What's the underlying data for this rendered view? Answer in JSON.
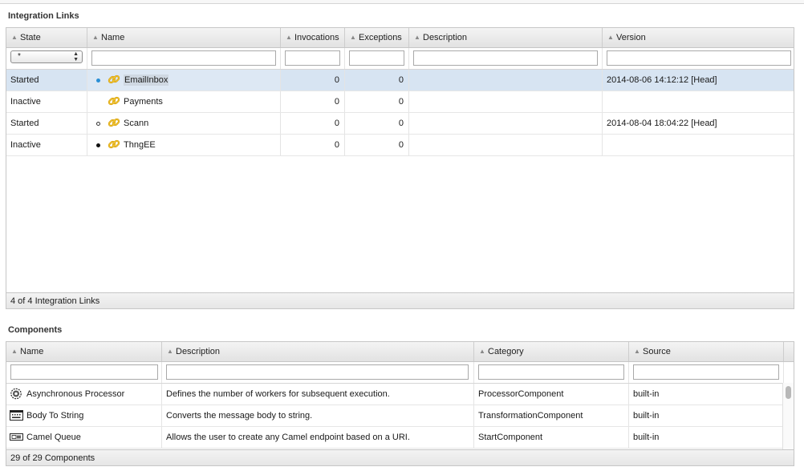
{
  "integration_links": {
    "title": "Integration Links",
    "columns": {
      "state": "State",
      "name": "Name",
      "invocations": "Invocations",
      "exceptions": "Exceptions",
      "description": "Description",
      "version": "Version"
    },
    "state_filter_value": "*",
    "rows": [
      {
        "state": "Started",
        "status_dot": "blue",
        "name": "EmailInbox",
        "invocations": "0",
        "exceptions": "0",
        "description": "",
        "version": "2014-08-06 14:12:12 [Head]"
      },
      {
        "state": "Inactive",
        "status_dot": "none",
        "name": "Payments",
        "invocations": "0",
        "exceptions": "0",
        "description": "",
        "version": ""
      },
      {
        "state": "Started",
        "status_dot": "open",
        "name": "Scann",
        "invocations": "0",
        "exceptions": "0",
        "description": "",
        "version": "2014-08-04 18:04:22 [Head]"
      },
      {
        "state": "Inactive",
        "status_dot": "black",
        "name": "ThngEE",
        "invocations": "0",
        "exceptions": "0",
        "description": "",
        "version": ""
      }
    ],
    "footer": "4 of 4 Integration Links",
    "icon": "chain-link-icon",
    "selected_row_color": "#d7e4f2"
  },
  "components": {
    "title": "Components",
    "columns": {
      "name": "Name",
      "description": "Description",
      "category": "Category",
      "source": "Source"
    },
    "rows": [
      {
        "icon": "gear-icon",
        "name": "Asynchronous Processor",
        "description": "Defines the number of workers for subsequent execution.",
        "category": "ProcessorComponent",
        "source": "built-in"
      },
      {
        "icon": "terminal-icon",
        "name": "Body To String",
        "description": "Converts the message body to string.",
        "category": "TransformationComponent",
        "source": "built-in"
      },
      {
        "icon": "queue-icon",
        "name": "Camel Queue",
        "description": "Allows the user to create any Camel endpoint based on a URI.",
        "category": "StartComponent",
        "source": "built-in"
      }
    ],
    "footer": "29 of 29 Components"
  }
}
